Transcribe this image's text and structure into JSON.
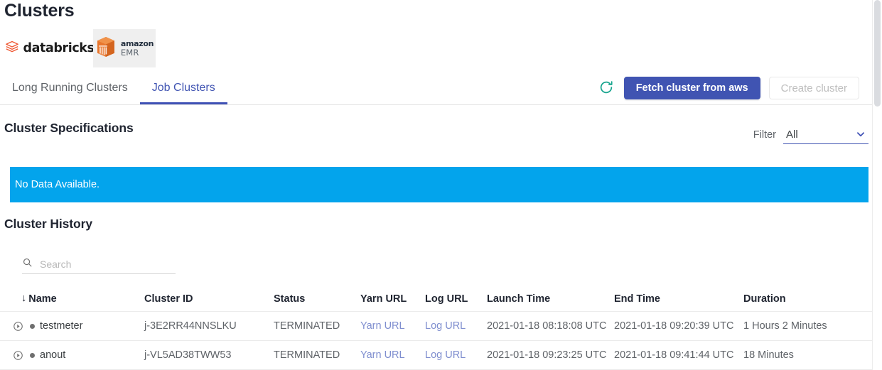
{
  "page": {
    "title": "Clusters"
  },
  "providers": [
    {
      "name": "databricks",
      "label": "databricks",
      "icon": "databricks-logo",
      "selected": false
    },
    {
      "name": "amazon-emr",
      "label_top": "amazon",
      "label_bottom": "EMR",
      "icon": "amazon-emr-logo",
      "selected": true
    }
  ],
  "tabs": [
    {
      "id": "long-running-clusters",
      "label": "Long Running Clusters",
      "active": false
    },
    {
      "id": "job-clusters",
      "label": "Job Clusters",
      "active": true
    }
  ],
  "toolbar": {
    "refresh_icon": "refresh-icon",
    "fetch_label": "Fetch cluster from aws",
    "create_label": "Create cluster"
  },
  "specs": {
    "heading": "Cluster Specifications",
    "filter_label": "Filter",
    "filter_value": "All",
    "filter_options": [
      "All"
    ],
    "empty_message": "No Data Available."
  },
  "history": {
    "heading": "Cluster History",
    "search_placeholder": "Search",
    "search_value": "",
    "search_icon": "search-icon",
    "sort_column": "Name",
    "sort_arrow": "↓",
    "columns": [
      {
        "key": "name",
        "label": "Name"
      },
      {
        "key": "cluster_id",
        "label": "Cluster ID"
      },
      {
        "key": "status",
        "label": "Status"
      },
      {
        "key": "yarn_url",
        "label": "Yarn URL"
      },
      {
        "key": "log_url",
        "label": "Log URL"
      },
      {
        "key": "launch_time",
        "label": "Launch Time"
      },
      {
        "key": "end_time",
        "label": "End Time"
      },
      {
        "key": "duration",
        "label": "Duration"
      }
    ],
    "rows": [
      {
        "name": "testmeter",
        "cluster_id": "j-3E2RR44NNSLKU",
        "status": "TERMINATED",
        "yarn_url": "Yarn URL",
        "log_url": "Log URL",
        "launch_time": "2021-01-18 08:18:08 UTC",
        "end_time": "2021-01-18 09:20:39 UTC",
        "duration": "1 Hours 2 Minutes"
      },
      {
        "name": "anout",
        "cluster_id": "j-VL5AD38TWW53",
        "status": "TERMINATED",
        "yarn_url": "Yarn URL",
        "log_url": "Log URL",
        "launch_time": "2021-01-18 09:23:25 UTC",
        "end_time": "2021-01-18 09:41:44 UTC",
        "duration": "18 Minutes"
      }
    ]
  },
  "colors": {
    "primary": "#4054b2",
    "tab_active": "#3f51b5",
    "banner": "#03a4ec",
    "link": "#7f8ecf",
    "refresh": "#1aa58f",
    "status_dot": "#6f6f6f",
    "emr_orange": "#e8762d",
    "databricks_red": "#ef5a35"
  }
}
